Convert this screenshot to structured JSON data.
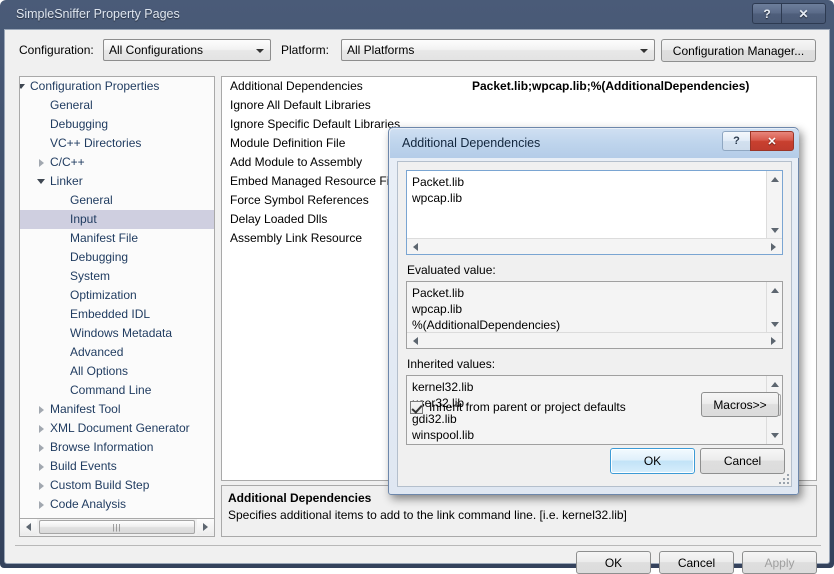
{
  "window": {
    "title": "SimpleSniffer Property Pages",
    "caption_buttons": [
      {
        "name": "help",
        "glyph": "?"
      },
      {
        "name": "close",
        "glyph": "✕"
      }
    ]
  },
  "config_row": {
    "configuration_label": "Configuration:",
    "configuration_value": "All Configurations",
    "platform_label": "Platform:",
    "platform_value": "All Platforms",
    "configuration_manager_button": "Configuration Manager..."
  },
  "tree": {
    "nodes": [
      {
        "label": "Configuration Properties",
        "indent": 0,
        "expander": "open",
        "selected": false
      },
      {
        "label": "General",
        "indent": 1,
        "expander": "none",
        "selected": false
      },
      {
        "label": "Debugging",
        "indent": 1,
        "expander": "none",
        "selected": false
      },
      {
        "label": "VC++ Directories",
        "indent": 1,
        "expander": "none",
        "selected": false
      },
      {
        "label": "C/C++",
        "indent": 1,
        "expander": "closed",
        "selected": false
      },
      {
        "label": "Linker",
        "indent": 1,
        "expander": "open",
        "selected": false
      },
      {
        "label": "General",
        "indent": 2,
        "expander": "none",
        "selected": false
      },
      {
        "label": "Input",
        "indent": 2,
        "expander": "none",
        "selected": true
      },
      {
        "label": "Manifest File",
        "indent": 2,
        "expander": "none",
        "selected": false
      },
      {
        "label": "Debugging",
        "indent": 2,
        "expander": "none",
        "selected": false
      },
      {
        "label": "System",
        "indent": 2,
        "expander": "none",
        "selected": false
      },
      {
        "label": "Optimization",
        "indent": 2,
        "expander": "none",
        "selected": false
      },
      {
        "label": "Embedded IDL",
        "indent": 2,
        "expander": "none",
        "selected": false
      },
      {
        "label": "Windows Metadata",
        "indent": 2,
        "expander": "none",
        "selected": false
      },
      {
        "label": "Advanced",
        "indent": 2,
        "expander": "none",
        "selected": false
      },
      {
        "label": "All Options",
        "indent": 2,
        "expander": "none",
        "selected": false
      },
      {
        "label": "Command Line",
        "indent": 2,
        "expander": "none",
        "selected": false
      },
      {
        "label": "Manifest Tool",
        "indent": 1,
        "expander": "closed",
        "selected": false
      },
      {
        "label": "XML Document Generator",
        "indent": 1,
        "expander": "closed",
        "selected": false
      },
      {
        "label": "Browse Information",
        "indent": 1,
        "expander": "closed",
        "selected": false
      },
      {
        "label": "Build Events",
        "indent": 1,
        "expander": "closed",
        "selected": false
      },
      {
        "label": "Custom Build Step",
        "indent": 1,
        "expander": "closed",
        "selected": false
      },
      {
        "label": "Code Analysis",
        "indent": 1,
        "expander": "closed",
        "selected": false
      }
    ],
    "hscroll_grip": "|||"
  },
  "properties": {
    "rows": [
      {
        "name": "Additional Dependencies",
        "value": "Packet.lib;wpcap.lib;%(AdditionalDependencies)"
      },
      {
        "name": "Ignore All Default Libraries",
        "value": ""
      },
      {
        "name": "Ignore Specific Default Libraries",
        "value": ""
      },
      {
        "name": "Module Definition File",
        "value": ""
      },
      {
        "name": "Add Module to Assembly",
        "value": ""
      },
      {
        "name": "Embed Managed Resource File",
        "value": ""
      },
      {
        "name": "Force Symbol References",
        "value": ""
      },
      {
        "name": "Delay Loaded Dlls",
        "value": ""
      },
      {
        "name": "Assembly Link Resource",
        "value": ""
      }
    ]
  },
  "description": {
    "title": "Additional Dependencies",
    "body": "Specifies additional items to add to the link command line. [i.e. kernel32.lib]"
  },
  "footer": {
    "ok": "OK",
    "cancel": "Cancel",
    "apply": "Apply",
    "apply_enabled": false
  },
  "dialog": {
    "title": "Additional Dependencies",
    "caption_buttons": [
      {
        "name": "help",
        "glyph": "?"
      },
      {
        "name": "close",
        "glyph": "✕"
      }
    ],
    "edit_value": "Packet.lib\nwpcap.lib",
    "evaluated_label": "Evaluated value:",
    "evaluated_value": "Packet.lib\nwpcap.lib\n%(AdditionalDependencies)",
    "inherited_label": "Inherited values:",
    "inherited_value": "kernel32.lib\nuser32.lib\ngdi32.lib\nwinspool.lib",
    "inherit_checkbox_label": "Inherit from parent or project defaults",
    "inherit_checkbox_checked": true,
    "macros_button": "Macros>>",
    "ok": "OK",
    "cancel": "Cancel"
  },
  "colors": {
    "window_chrome": "#3d4d68",
    "dialog_titlebar": "#bed4ec",
    "close_red": "#c8402f",
    "selection": "#cfcfe0",
    "tree_text": "#1e3a5f",
    "focus_blue": "#3c9bd6"
  }
}
